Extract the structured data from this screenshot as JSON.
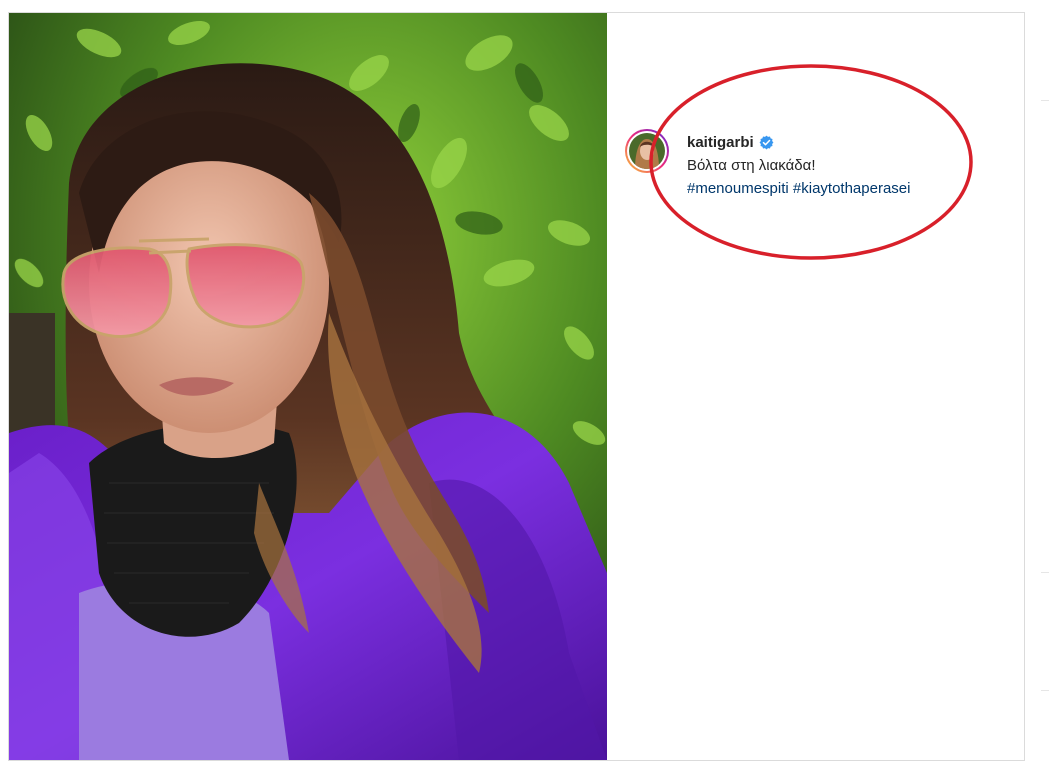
{
  "post": {
    "username": "kaitigarbi",
    "verified": true,
    "caption": "Βόλτα στη λιακάδα!",
    "hashtags": [
      "#menoumespiti",
      "#kiaytothaperasei"
    ]
  },
  "annotation": {
    "color": "#d8202a"
  },
  "colors": {
    "hashtag": "#00376b",
    "verified_badge": "#3897f0",
    "text": "#262626"
  }
}
